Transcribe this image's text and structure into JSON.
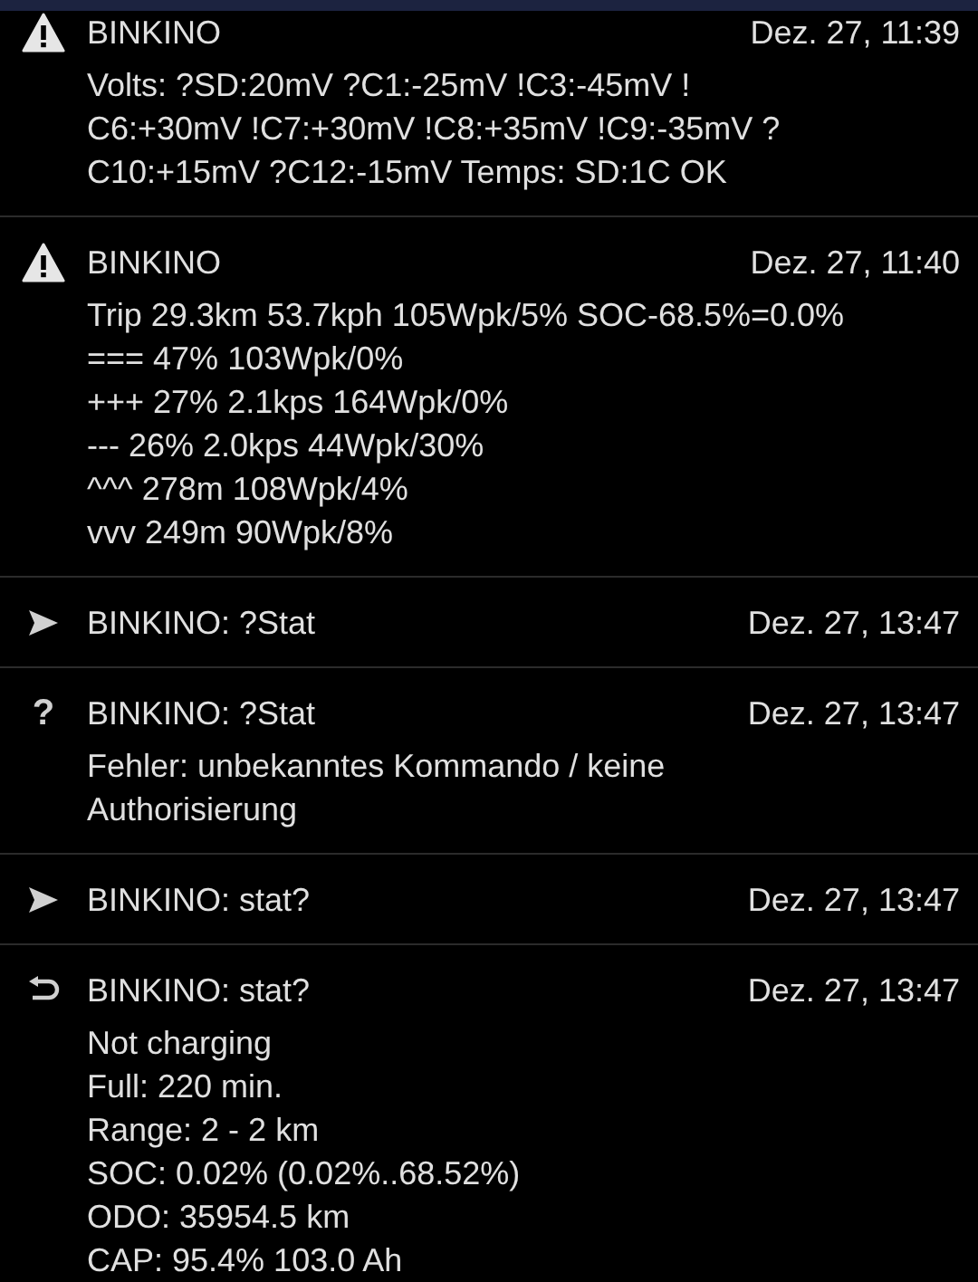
{
  "messages": [
    {
      "kind": "warning",
      "sender": "BINKINO",
      "time": "Dez. 27, 11:39",
      "lines": [
        "Volts: ?SD:20mV ?C1:-25mV !C3:-45mV !",
        "C6:+30mV !C7:+30mV !C8:+35mV !C9:-35mV ?",
        "C10:+15mV ?C12:-15mV Temps: SD:1C OK"
      ]
    },
    {
      "kind": "warning",
      "sender": "BINKINO",
      "time": "Dez. 27, 11:40",
      "lines": [
        "Trip 29.3km 53.7kph 105Wpk/5% SOC-68.5%=0.0%",
        "=== 47% 103Wpk/0%",
        "+++ 27% 2.1kps 164Wpk/0%",
        "--- 26% 2.0kps 44Wpk/30%",
        "^^^ 278m 108Wpk/4%",
        "vvv 249m 90Wpk/8%"
      ]
    },
    {
      "kind": "sent",
      "sender": "BINKINO: ?Stat",
      "time": "Dez. 27, 13:47"
    },
    {
      "kind": "question",
      "icon": "?",
      "sender": "BINKINO: ?Stat",
      "time": "Dez. 27, 13:47",
      "lines": [
        "Fehler: unbekanntes Kommando / keine",
        "Authorisierung"
      ]
    },
    {
      "kind": "sent",
      "sender": "BINKINO: stat?",
      "time": "Dez. 27, 13:47"
    },
    {
      "kind": "reply",
      "sender": "BINKINO: stat?",
      "time": "Dez. 27, 13:47",
      "lines": [
        "Not charging",
        "Full: 220 min.",
        "Range: 2 - 2 km",
        "SOC: 0.02% (0.02%..68.52%)",
        "ODO: 35954.5 km",
        "CAP: 95.4% 103.0 Ah"
      ]
    }
  ]
}
